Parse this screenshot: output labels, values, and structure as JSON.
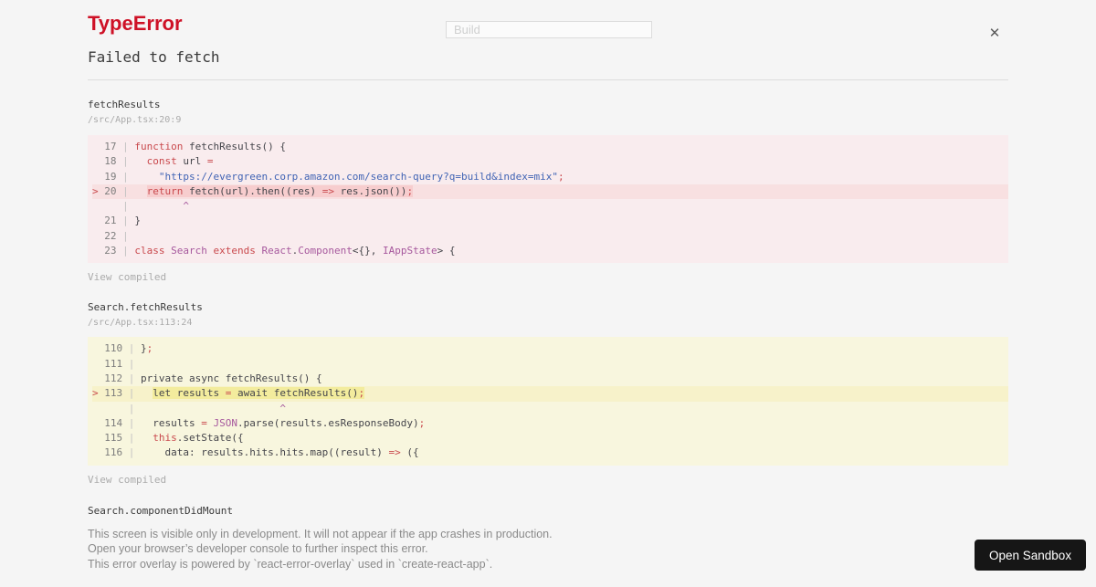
{
  "header": {
    "error_type": "TypeError",
    "error_message": "Failed to fetch"
  },
  "search": {
    "value": "Build"
  },
  "close_icon": "✕",
  "frames": [
    {
      "function_name": "fetchResults",
      "location": "/src/App.tsx:20:9",
      "view_link": "View compiled",
      "variant": "error",
      "num_width": 2,
      "lines": [
        {
          "num": "17",
          "mk": "",
          "segs": [
            [
              "k",
              "function"
            ],
            [
              "p",
              " fetchResults() {"
            ]
          ]
        },
        {
          "num": "18",
          "mk": "",
          "segs": [
            [
              "p",
              "  "
            ],
            [
              "k",
              "const"
            ],
            [
              "p",
              " url "
            ],
            [
              "k",
              "="
            ]
          ]
        },
        {
          "num": "19",
          "mk": "",
          "segs": [
            [
              "p",
              "    "
            ],
            [
              "s",
              "\"https://evergreen.corp.amazon.com/search-query?q=build&index=mix\""
            ],
            [
              "k",
              ";"
            ]
          ]
        },
        {
          "num": "20",
          "mk": ">",
          "hl": true,
          "pre": "  ",
          "segs": [
            [
              "k",
              "return"
            ],
            [
              "p",
              " fetch(url).then((res) "
            ],
            [
              "k",
              "=>"
            ],
            [
              "p",
              " res.json())"
            ],
            [
              "k",
              ";"
            ]
          ]
        },
        {
          "num": "",
          "mk": "",
          "segs": [
            [
              "p",
              "        "
            ],
            [
              "u",
              "^"
            ]
          ]
        },
        {
          "num": "21",
          "mk": "",
          "segs": [
            [
              "p",
              "}"
            ]
          ]
        },
        {
          "num": "22",
          "mk": "",
          "segs": []
        },
        {
          "num": "23",
          "mk": "",
          "segs": [
            [
              "k",
              "class"
            ],
            [
              "p",
              " "
            ],
            [
              "u",
              "Search"
            ],
            [
              "p",
              " "
            ],
            [
              "k",
              "extends"
            ],
            [
              "p",
              " "
            ],
            [
              "u",
              "React"
            ],
            [
              "p",
              "."
            ],
            [
              "u",
              "Component"
            ],
            [
              "p",
              "<{}, "
            ],
            [
              "u",
              "IAppState"
            ],
            [
              "p",
              "> {"
            ]
          ]
        }
      ]
    },
    {
      "function_name": "Search.fetchResults",
      "location": "/src/App.tsx:113:24",
      "view_link": "View compiled",
      "variant": "warning",
      "num_width": 3,
      "lines": [
        {
          "num": "110",
          "mk": "",
          "segs": [
            [
              "p",
              "}"
            ],
            [
              "k",
              ";"
            ]
          ]
        },
        {
          "num": "111",
          "mk": "",
          "segs": []
        },
        {
          "num": "112",
          "mk": "",
          "segs": [
            [
              "p",
              "private async fetchResults() {"
            ]
          ]
        },
        {
          "num": "113",
          "mk": ">",
          "hl": true,
          "pre": "  ",
          "segs": [
            [
              "p",
              "let results "
            ],
            [
              "k",
              "="
            ],
            [
              "p",
              " await fetchResults()"
            ],
            [
              "k",
              ";"
            ]
          ]
        },
        {
          "num": "",
          "mk": "",
          "segs": [
            [
              "p",
              "                       "
            ],
            [
              "u",
              "^"
            ]
          ]
        },
        {
          "num": "114",
          "mk": "",
          "segs": [
            [
              "p",
              "  results "
            ],
            [
              "k",
              "="
            ],
            [
              "p",
              " "
            ],
            [
              "u",
              "JSON"
            ],
            [
              "p",
              ".parse(results.esResponseBody)"
            ],
            [
              "k",
              ";"
            ]
          ]
        },
        {
          "num": "115",
          "mk": "",
          "segs": [
            [
              "p",
              "  "
            ],
            [
              "k",
              "this"
            ],
            [
              "p",
              ".setState({"
            ]
          ]
        },
        {
          "num": "116",
          "mk": "",
          "segs": [
            [
              "p",
              "    data: results.hits.hits.map((result) "
            ],
            [
              "k",
              "=>"
            ],
            [
              "p",
              " ({"
            ]
          ]
        }
      ]
    }
  ],
  "collapsed_frame": {
    "function_name": "Search.componentDidMount"
  },
  "footer": {
    "lines": [
      "This screen is visible only in development. It will not appear if the app crashes in production.",
      "Open your browser’s developer console to further inspect this error.",
      "This error overlay is powered by `react-error-overlay` used in `create-react-app`."
    ]
  },
  "sandbox": {
    "button_label": "Open Sandbox"
  },
  "colors": {
    "error_red": "#ce1126",
    "keyword": "#c9494d",
    "string": "#4063b4",
    "identifier": "#a6589d",
    "frame_error_bg": "#f9ecee",
    "frame_warning_bg": "#f8f6de",
    "mark_error_bg": "#f7cdce",
    "mark_warning_bg": "#f3ec9d",
    "sandbox_button_bg": "#161616"
  }
}
